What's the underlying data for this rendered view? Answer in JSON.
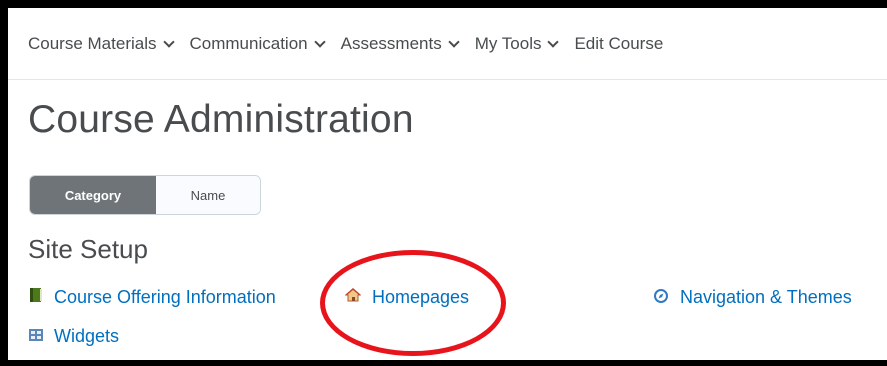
{
  "nav": {
    "items": [
      {
        "label": "Course Materials",
        "has_dropdown": true
      },
      {
        "label": "Communication",
        "has_dropdown": true
      },
      {
        "label": "Assessments",
        "has_dropdown": true
      },
      {
        "label": "My Tools",
        "has_dropdown": true
      },
      {
        "label": "Edit Course",
        "has_dropdown": false
      }
    ]
  },
  "page": {
    "title": "Course Administration"
  },
  "view_toggle": {
    "category_label": "Category",
    "name_label": "Name",
    "selected": "Category"
  },
  "section": {
    "heading": "Site Setup",
    "links": [
      {
        "label": "Course Offering Information",
        "icon": "green-book-icon"
      },
      {
        "label": "Homepages",
        "icon": "house-icon"
      },
      {
        "label": "Navigation & Themes",
        "icon": "compass-icon"
      },
      {
        "label": "Widgets",
        "icon": "widget-grid-icon"
      }
    ]
  },
  "colors": {
    "link": "#006fbf",
    "text": "#494c4e",
    "toggle_active": "#6e7477",
    "annotation": "#e8141b"
  }
}
